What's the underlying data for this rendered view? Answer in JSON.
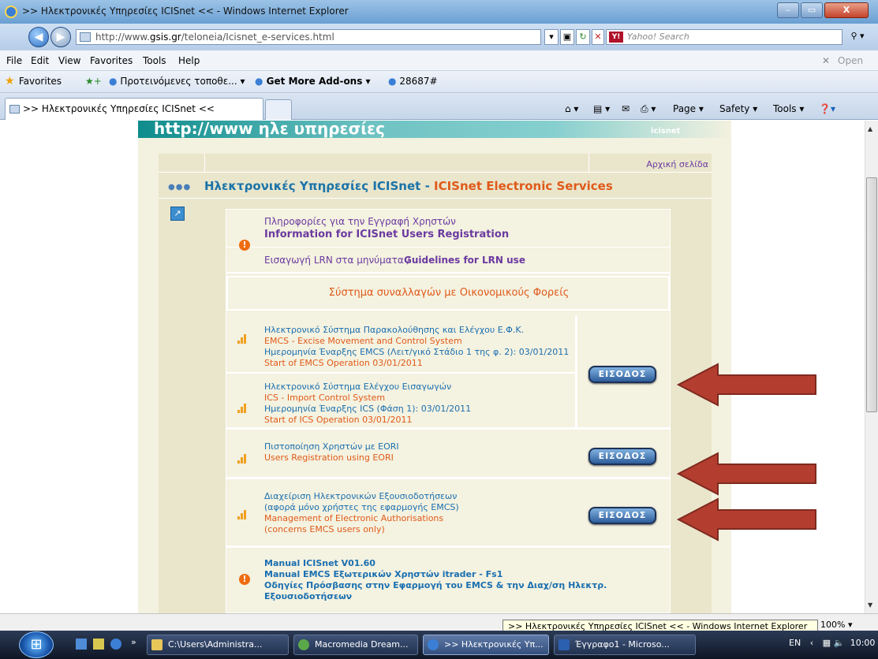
{
  "window": {
    "title": ">> Ηλεκτρονικές Υπηρεσίες ICISnet << - Windows Internet Explorer",
    "min_label": "–",
    "max_label": "▭",
    "close_label": "X"
  },
  "address": {
    "url_prefix": "http://www.",
    "url_host": "gsis.gr",
    "url_path": "/teloneia/Icisnet_e-services.html",
    "search_placeholder": "Yahoo! Search",
    "search_logo": "Y!"
  },
  "menu": {
    "items": [
      "File",
      "Edit",
      "View",
      "Favorites",
      "Tools",
      "Help"
    ],
    "right_label": "Open"
  },
  "favorites": {
    "label": "Favorites",
    "items": [
      "Προτεινόμενες τοποθε... ▾",
      "Get More Add-ons ▾",
      "28687#"
    ]
  },
  "tab": {
    "label": ">> Ηλεκτρονικές Υπηρεσίες ICISnet <<",
    "commands": [
      "Page ▾",
      "Safety ▾",
      "Tools ▾"
    ]
  },
  "page": {
    "banner": "http://www ηλε υπηρεσίες",
    "banner_right": "icisnet",
    "home_link": "Αρχική σελίδα",
    "title_greek": "Ηλεκτρονικές Υπηρεσίες ICISnet",
    "title_sep": " - ",
    "title_english": "ICISnet Electronic Services",
    "reg_greek": "Πληροφορίες για την Εγγραφή Χρηστών",
    "reg_english": "Information for ICISnet Users Registration",
    "lrn_greek": "Εισαγωγή LRN στα μηνύματα / ",
    "lrn_english": "Guidelines for LRN use",
    "system_title": "Σύστημα συναλλαγών με Οικονομικούς Φορείς",
    "emcs": [
      "Ηλεκτρονικό Σύστημα Παρακολούθησης και Ελέγχου Ε.Φ.Κ.",
      "EMCS - Excise Movement and Control System",
      "Ημερομηνία Έναρξης EMCS (Λειτ/γικό Στάδιο 1 της φ. 2):  03/01/2011",
      "Start of EMCS Operation 03/01/2011"
    ],
    "ics": [
      "Ηλεκτρονικό Σύστημα Ελέγχου Εισαγωγών",
      "ICS - Import Control System",
      "Ημερομηνία Έναρξης ICS (Φάση 1): 03/01/2011",
      "Start of ICS Operation 03/01/2011"
    ],
    "eori": [
      "Πιστοποίηση Χρηστών με EORI",
      "Users Registration using EORI"
    ],
    "auth": [
      "Διαχείριση Ηλεκτρονικών Εξουσιοδοτήσεων",
      "(αφορά μόνο χρήστες της εφαρμογής EMCS)",
      "Management of Electronic Authorisations",
      "(concerns EMCS users only)"
    ],
    "manuals": [
      "Manual ICISnet V01.60",
      "Manual EMCS Εξωτερικών Χρηστών itrader - Fs1",
      "Οδηγίες Πρόσβασης στην Εφαρμογή του EMCS & την Διαχ/ση Ηλεκτρ.",
      "Εξουσιοδοτήσεων"
    ],
    "enter_button": "ΕΙΣΟΔΟΣ"
  },
  "status": {
    "tooltip": ">> Ηλεκτρονικές Υπηρεσίες ICISnet << - Windows Internet Explorer",
    "zoom": "100%  ▾"
  },
  "taskbar": {
    "items": [
      "C:\\Users\\Administra...",
      "Macromedia Dream...",
      ">> Ηλεκτρονικές Υπ...",
      "Έγγραφο1 - Microso..."
    ],
    "lang": "EN",
    "clock": "10:00 πμ"
  },
  "colors": {
    "arrow": "#b33d2f",
    "accent_teal": "#1a73a8",
    "accent_orange": "#e05a1a"
  }
}
